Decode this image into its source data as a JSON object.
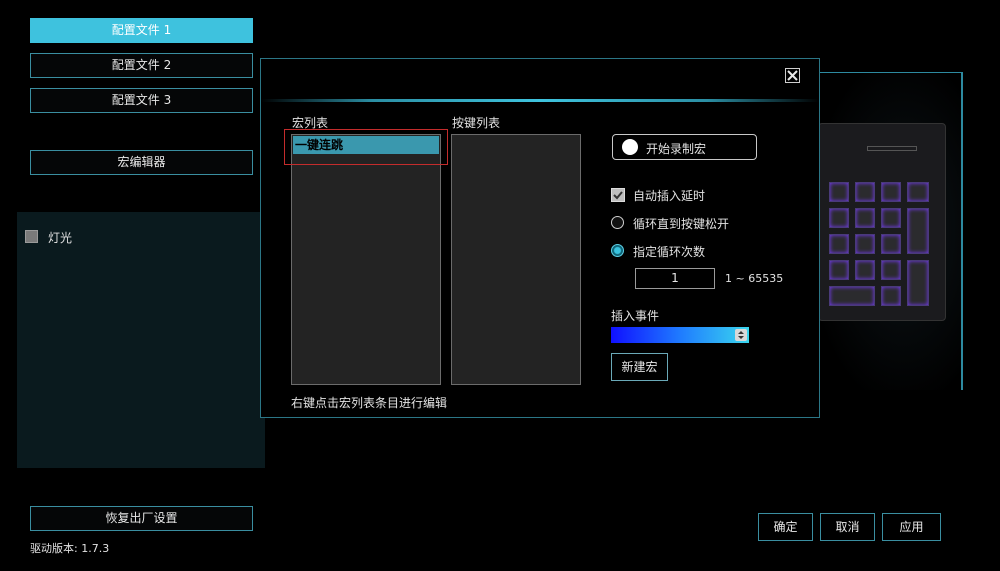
{
  "sidebar": {
    "profiles": [
      {
        "label": "配置文件 1",
        "active": true
      },
      {
        "label": "配置文件 2",
        "active": false
      },
      {
        "label": "配置文件 3",
        "active": false
      }
    ],
    "macro_editor_label": "宏编辑器",
    "light_label": "灯光",
    "factory_reset_label": "恢复出厂设置",
    "driver_version": "驱动版本: 1.7.3"
  },
  "dialog": {
    "close_icon": "close-icon",
    "macro_list_title": "宏列表",
    "macro_items": [
      "一键连跳"
    ],
    "key_list_title": "按键列表",
    "record_button_label": "开始录制宏",
    "auto_delay_label": "自动插入延时",
    "loop_until_release_label": "循环直到按键松开",
    "loop_count_label": "指定循环次数",
    "loop_count_value": "1",
    "loop_count_range": "1 ~ 65535",
    "insert_event_label": "插入事件",
    "new_macro_label": "新建宏",
    "hint_text": "右键点击宏列表条目进行编辑"
  },
  "footer": {
    "ok_label": "确定",
    "cancel_label": "取消",
    "apply_label": "应用"
  },
  "colors": {
    "accent": "#3ec2de",
    "border": "#3a8ea0",
    "selected_item": "#3a98ae",
    "highlight_box": "#c42c2c"
  }
}
